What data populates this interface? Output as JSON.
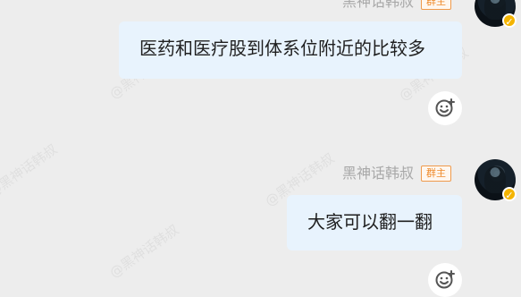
{
  "messages": [
    {
      "sender": "黑神话韩叔",
      "role": "群主",
      "text": "医药和医疗股到体系位附近的比较多"
    },
    {
      "sender": "黑神话韩叔",
      "role": "群主",
      "text": "大家可以翻一翻"
    }
  ],
  "watermarks": [
    "@黑神话韩叔",
    "@黑神话韩叔",
    "@黑神话韩叔",
    "@黑神话韩叔",
    "@黑神话韩叔"
  ],
  "icons": {
    "reaction": "emoji-add-icon",
    "verified": "verified-badge-icon"
  },
  "colors": {
    "background": "#ededed",
    "bubble": "#e8f3fd",
    "badge_border": "#ef9a4c",
    "badge_text": "#ef8a2a",
    "verified": "#f4b400"
  }
}
